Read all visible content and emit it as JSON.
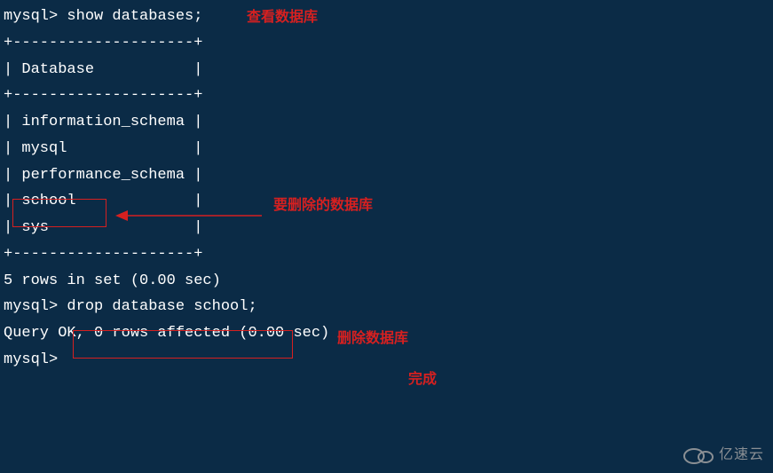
{
  "terminal": {
    "line1_prompt": "mysql> ",
    "line1_cmd": "show databases;",
    "border_top": "+--------------------+",
    "header_row": "| Database           |",
    "border_mid": "+--------------------+",
    "row1": "| information_schema |",
    "row2": "| mysql              |",
    "row3": "| performance_schema |",
    "row4": "| school             |",
    "row5": "| sys                |",
    "border_bot": "+--------------------+",
    "result1": "5 rows in set (0.00 sec)",
    "blank": "",
    "line2_prompt": "mysql> ",
    "line2_cmd": "drop database school;",
    "result2": "Query OK, 0 rows affected (0.00 sec)",
    "line3_prompt": "mysql>"
  },
  "annotations": {
    "view_db": "查看数据库",
    "to_delete": "要删除的数据库",
    "delete_db": "删除数据库",
    "done": "完成"
  },
  "watermark": {
    "text": "亿速云"
  }
}
